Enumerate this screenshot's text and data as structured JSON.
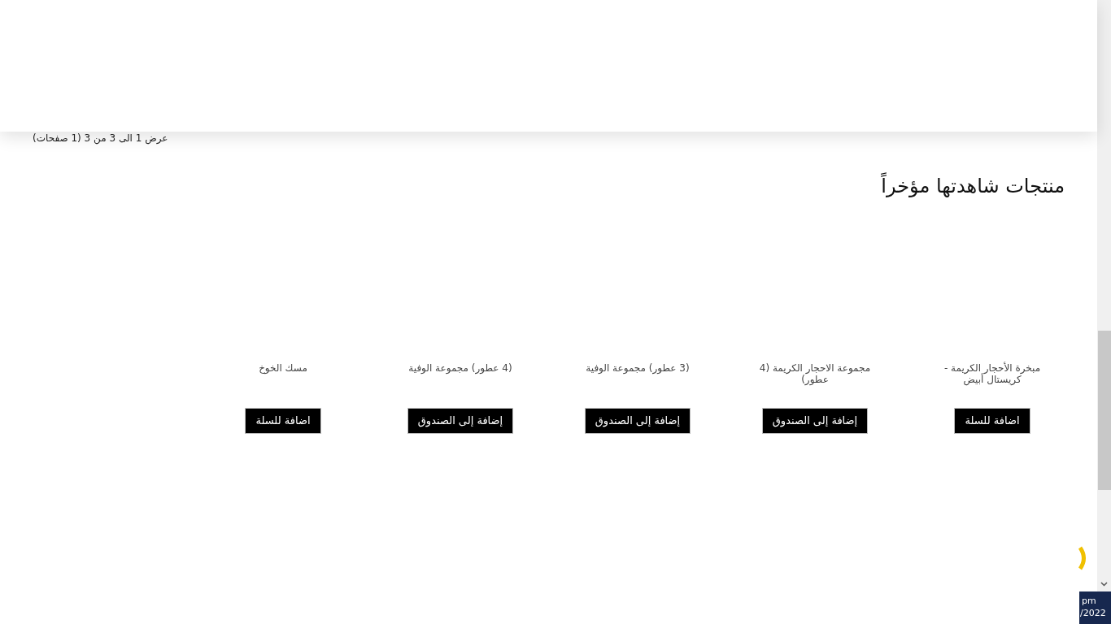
{
  "pagination_summary": "عرض 1 الى 3 من 3 (1 صفحات)",
  "recently_viewed": {
    "title": "منتجات شاهدتها مؤخراً",
    "products": [
      {
        "name": "مبخرة الأحجار الكريمة - كريستال أبيض",
        "button": "اضافة للسلة"
      },
      {
        "name": "مجموعة الاحجار الكريمة (4 عطور)",
        "button": "إضافة إلى الصندوق"
      },
      {
        "name": "(3 عطور) مجموعة الوفية",
        "button": "إضافة إلى الصندوق"
      },
      {
        "name": "(4 عطور) مجموعة الوفية",
        "button": "إضافة إلى الصندوق"
      },
      {
        "name": "مسك الخوخ",
        "button": "اضافة للسلة"
      }
    ]
  },
  "taskbar_clock": {
    "time": "pm",
    "date": "/2022"
  }
}
